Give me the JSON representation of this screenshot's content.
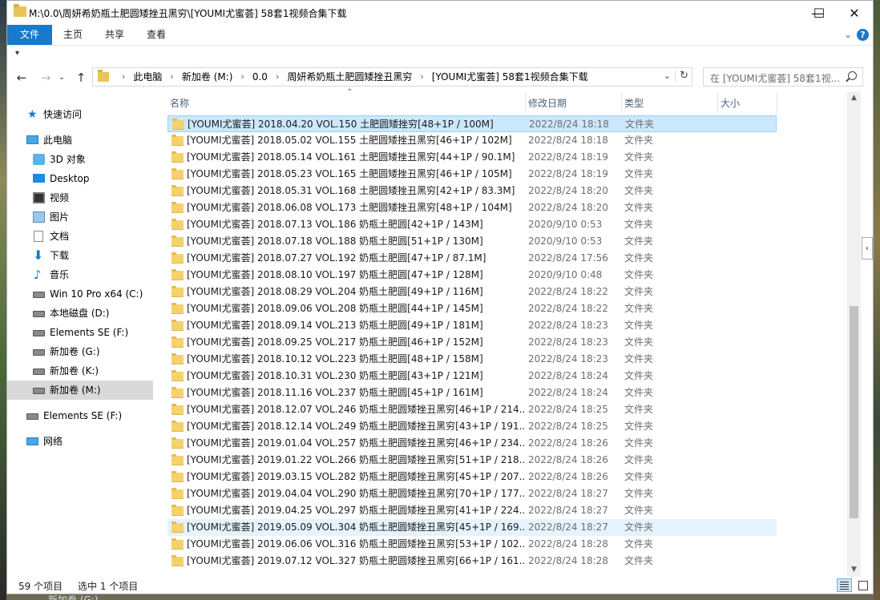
{
  "window": {
    "title": "M:\\0.0\\周妍希奶瓶土肥圆矮挫丑黑穷\\[YOUMI尤蜜荟] 58套1视频合集下载",
    "minimize": "—",
    "maximize": "☐",
    "close": "✕"
  },
  "ribbon": {
    "tabs": [
      "文件",
      "主页",
      "共享",
      "查看"
    ],
    "expand": "⌄",
    "help": "?"
  },
  "address": {
    "crumbs": [
      "此电脑",
      "新加卷 (M:)",
      "0.0",
      "周妍希奶瓶土肥圆矮挫丑黑穷",
      "[YOUMI尤蜜荟] 58套1视频合集下载"
    ],
    "search_placeholder": "在 [YOUMI尤蜜荟] 58套1视..."
  },
  "navpane": {
    "items": [
      {
        "label": "快速访问",
        "icon": "star-icon"
      },
      {
        "label": "此电脑",
        "icon": "computer-icon"
      },
      {
        "label": "3D 对象",
        "icon": "3d-objects-icon"
      },
      {
        "label": "Desktop",
        "icon": "desktop-icon"
      },
      {
        "label": "视频",
        "icon": "video-icon"
      },
      {
        "label": "图片",
        "icon": "pictures-icon"
      },
      {
        "label": "文档",
        "icon": "documents-icon"
      },
      {
        "label": "下载",
        "icon": "download-icon"
      },
      {
        "label": "音乐",
        "icon": "music-icon"
      },
      {
        "label": "Win 10 Pro x64 (C:)",
        "icon": "drive-icon"
      },
      {
        "label": "本地磁盘 (D:)",
        "icon": "drive-icon"
      },
      {
        "label": "Elements SE (F:)",
        "icon": "drive-icon"
      },
      {
        "label": "新加卷 (G:)",
        "icon": "drive-icon"
      },
      {
        "label": "新加卷 (K:)",
        "icon": "drive-icon"
      },
      {
        "label": "新加卷 (M:)",
        "icon": "drive-icon"
      },
      {
        "label": "Elements SE (F:)",
        "icon": "drive-icon"
      },
      {
        "label": "网络",
        "icon": "network-icon"
      }
    ]
  },
  "columns": {
    "name": "名称",
    "date": "修改日期",
    "type": "类型",
    "size": "大小"
  },
  "files": [
    {
      "name": "[YOUMI尤蜜荟] 2018.04.20 VOL.150 土肥圆矮挫穷[48+1P / 100M]",
      "date": "2022/8/24 18:18",
      "type": "文件夹"
    },
    {
      "name": "[YOUMI尤蜜荟] 2018.05.02 VOL.155 土肥圆矮挫丑黑穷[46+1P / 102M]",
      "date": "2022/8/24 18:18",
      "type": "文件夹"
    },
    {
      "name": "[YOUMI尤蜜荟] 2018.05.14 VOL.161 土肥圆矮挫丑黑穷[44+1P / 90.1M]",
      "date": "2022/8/24 18:19",
      "type": "文件夹"
    },
    {
      "name": "[YOUMI尤蜜荟] 2018.05.23 VOL.165 土肥圆矮挫丑黑穷[46+1P / 105M]",
      "date": "2022/8/24 18:19",
      "type": "文件夹"
    },
    {
      "name": "[YOUMI尤蜜荟] 2018.05.31 VOL.168 土肥圆矮挫丑黑穷[42+1P / 83.3M]",
      "date": "2022/8/24 18:20",
      "type": "文件夹"
    },
    {
      "name": "[YOUMI尤蜜荟] 2018.06.08 VOL.173 土肥圆矮挫丑黑穷[48+1P / 104M]",
      "date": "2022/8/24 18:20",
      "type": "文件夹"
    },
    {
      "name": "[YOUMI尤蜜荟] 2018.07.13 VOL.186 奶瓶土肥圆[42+1P / 143M]",
      "date": "2020/9/10 0:53",
      "type": "文件夹"
    },
    {
      "name": "[YOUMI尤蜜荟] 2018.07.18 VOL.188 奶瓶土肥圆[51+1P / 130M]",
      "date": "2020/9/10 0:53",
      "type": "文件夹"
    },
    {
      "name": "[YOUMI尤蜜荟] 2018.07.27 VOL.192 奶瓶土肥圆[47+1P / 87.1M]",
      "date": "2022/8/24 17:56",
      "type": "文件夹"
    },
    {
      "name": "[YOUMI尤蜜荟] 2018.08.10 VOL.197 奶瓶土肥圆[47+1P / 128M]",
      "date": "2020/9/10 0:48",
      "type": "文件夹"
    },
    {
      "name": "[YOUMI尤蜜荟] 2018.08.29 VOL.204 奶瓶土肥圆[49+1P / 116M]",
      "date": "2022/8/24 18:22",
      "type": "文件夹"
    },
    {
      "name": "[YOUMI尤蜜荟] 2018.09.06 VOL.208 奶瓶土肥圆[44+1P / 145M]",
      "date": "2022/8/24 18:22",
      "type": "文件夹"
    },
    {
      "name": "[YOUMI尤蜜荟] 2018.09.14 VOL.213 奶瓶土肥圆[49+1P / 181M]",
      "date": "2022/8/24 18:23",
      "type": "文件夹"
    },
    {
      "name": "[YOUMI尤蜜荟] 2018.09.25 VOL.217 奶瓶土肥圆[46+1P / 152M]",
      "date": "2022/8/24 18:23",
      "type": "文件夹"
    },
    {
      "name": "[YOUMI尤蜜荟] 2018.10.12 VOL.223 奶瓶土肥圆[48+1P / 158M]",
      "date": "2022/8/24 18:23",
      "type": "文件夹"
    },
    {
      "name": "[YOUMI尤蜜荟] 2018.10.31 VOL.230 奶瓶土肥圆[43+1P / 121M]",
      "date": "2022/8/24 18:24",
      "type": "文件夹"
    },
    {
      "name": "[YOUMI尤蜜荟] 2018.11.16 VOL.237 奶瓶土肥圆[45+1P / 161M]",
      "date": "2022/8/24 18:24",
      "type": "文件夹"
    },
    {
      "name": "[YOUMI尤蜜荟] 2018.12.07 VOL.246 奶瓶土肥圆矮挫丑黑穷[46+1P / 214...",
      "date": "2022/8/24 18:25",
      "type": "文件夹"
    },
    {
      "name": "[YOUMI尤蜜荟] 2018.12.14 VOL.249 奶瓶土肥圆矮挫丑黑穷[43+1P / 191...",
      "date": "2022/8/24 18:25",
      "type": "文件夹"
    },
    {
      "name": "[YOUMI尤蜜荟] 2019.01.04 VOL.257 奶瓶土肥圆矮挫丑黑穷[46+1P / 234...",
      "date": "2022/8/24 18:26",
      "type": "文件夹"
    },
    {
      "name": "[YOUMI尤蜜荟] 2019.01.22 VOL.266 奶瓶土肥圆矮挫丑黑穷[51+1P / 218...",
      "date": "2022/8/24 18:26",
      "type": "文件夹"
    },
    {
      "name": "[YOUMI尤蜜荟] 2019.03.15 VOL.282 奶瓶土肥圆矮挫丑黑穷[45+1P / 207...",
      "date": "2022/8/24 18:26",
      "type": "文件夹"
    },
    {
      "name": "[YOUMI尤蜜荟] 2019.04.04 VOL.290 奶瓶土肥圆矮挫丑黑穷[70+1P / 177...",
      "date": "2022/8/24 18:27",
      "type": "文件夹"
    },
    {
      "name": "[YOUMI尤蜜荟] 2019.04.25 VOL.297 奶瓶土肥圆矮挫丑黑穷[41+1P / 224...",
      "date": "2022/8/24 18:27",
      "type": "文件夹"
    },
    {
      "name": "[YOUMI尤蜜荟] 2019.05.09 VOL.304 奶瓶土肥圆矮挫丑黑穷[45+1P / 169...",
      "date": "2022/8/24 18:27",
      "type": "文件夹"
    },
    {
      "name": "[YOUMI尤蜜荟] 2019.06.06 VOL.316 奶瓶土肥圆矮挫丑黑穷[53+1P / 102...",
      "date": "2022/8/24 18:28",
      "type": "文件夹"
    },
    {
      "name": "[YOUMI尤蜜荟] 2019.07.12 VOL.327 奶瓶土肥圆矮挫丑黑穷[66+1P / 161...",
      "date": "2022/8/24 18:28",
      "type": "文件夹"
    }
  ],
  "status": {
    "count": "59 个项目",
    "selected": "选中 1 个项目"
  },
  "peek_text": "新加卷 (G:)",
  "colors": {
    "accent": "#1979ca",
    "selected_row": "#cce8ff",
    "hover_row": "#e5f3ff",
    "folder": "#f5d26b"
  }
}
